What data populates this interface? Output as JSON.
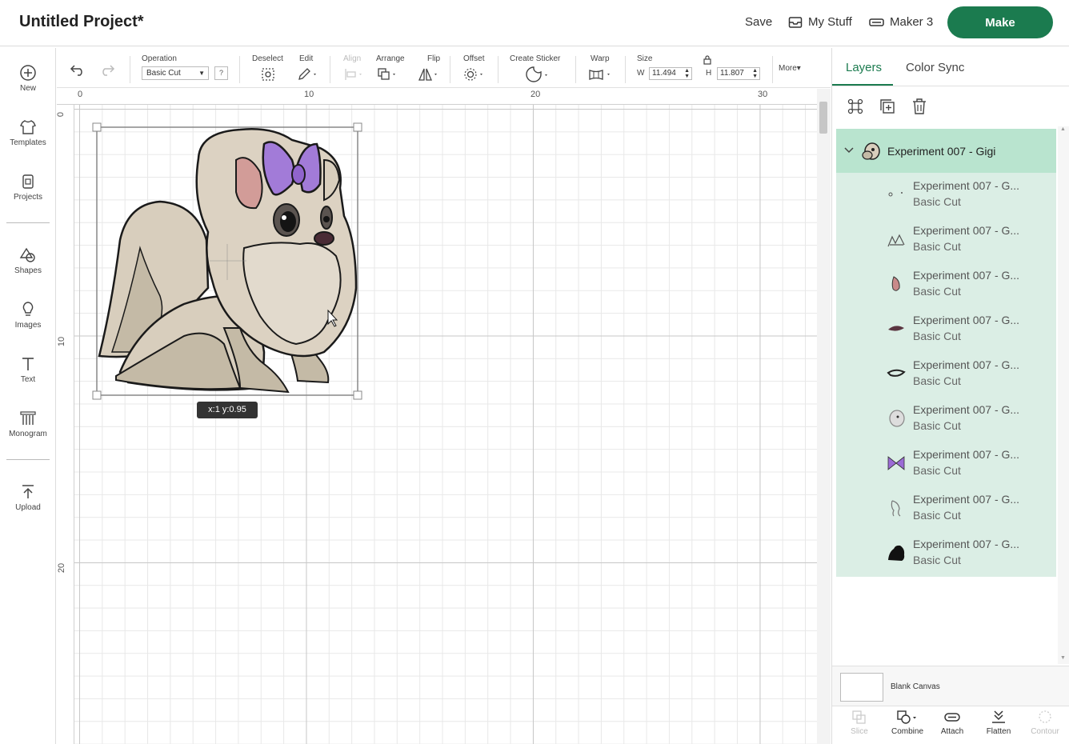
{
  "header": {
    "title": "Untitled Project*",
    "save_label": "Save",
    "my_stuff_label": "My Stuff",
    "machine_label": "Maker 3",
    "make_label": "Make"
  },
  "sidebar": {
    "items": [
      {
        "label": "New",
        "icon": "plus-circle-icon"
      },
      {
        "label": "Templates",
        "icon": "shirt-icon"
      },
      {
        "label": "Projects",
        "icon": "projects-icon"
      },
      {
        "label": "Shapes",
        "icon": "shapes-icon"
      },
      {
        "label": "Images",
        "icon": "lightbulb-icon"
      },
      {
        "label": "Text",
        "icon": "text-icon"
      },
      {
        "label": "Monogram",
        "icon": "monogram-icon"
      },
      {
        "label": "Upload",
        "icon": "upload-icon"
      }
    ]
  },
  "toolbar": {
    "operation_label": "Operation",
    "operation_value": "Basic Cut",
    "help_label": "?",
    "deselect_label": "Deselect",
    "edit_label": "Edit",
    "align_label": "Align",
    "arrange_label": "Arrange",
    "flip_label": "Flip",
    "offset_label": "Offset",
    "sticker_label": "Create Sticker",
    "warp_label": "Warp",
    "size_label": "Size",
    "w_label": "W",
    "w_value": "11.494",
    "h_label": "H",
    "h_value": "11.807",
    "more_label": "More▾"
  },
  "canvas": {
    "ruler_top": [
      "0",
      "10",
      "20",
      "30"
    ],
    "ruler_left": [
      "0",
      "10",
      "20"
    ],
    "coordinate_tooltip": "x:1 y:0.95"
  },
  "panel": {
    "tabs": [
      "Layers",
      "Color Sync"
    ],
    "group_name": "Experiment 007 - Gigi",
    "layers": [
      {
        "name": "Experiment 007 - G...",
        "op": "Basic Cut",
        "thumb": "dots",
        "color": "#555555"
      },
      {
        "name": "Experiment 007 - G...",
        "op": "Basic Cut",
        "thumb": "sketch",
        "color": "#555555"
      },
      {
        "name": "Experiment 007 - G...",
        "op": "Basic Cut",
        "thumb": "ear",
        "color": "#c98a8a"
      },
      {
        "name": "Experiment 007 - G...",
        "op": "Basic Cut",
        "thumb": "nose",
        "color": "#5a3540"
      },
      {
        "name": "Experiment 007 - G...",
        "op": "Basic Cut",
        "thumb": "eye",
        "color": "#222222"
      },
      {
        "name": "Experiment 007 - G...",
        "op": "Basic Cut",
        "thumb": "body",
        "color": "#888888"
      },
      {
        "name": "Experiment 007 - G...",
        "op": "Basic Cut",
        "thumb": "bow",
        "color": "#9b6bd6"
      },
      {
        "name": "Experiment 007 - G...",
        "op": "Basic Cut",
        "thumb": "outline",
        "color": "#777777"
      },
      {
        "name": "Experiment 007 - G...",
        "op": "Basic Cut",
        "thumb": "silhouette",
        "color": "#111111"
      }
    ],
    "blank_canvas_label": "Blank Canvas",
    "bottom_actions": [
      {
        "label": "Slice",
        "enabled": false
      },
      {
        "label": "Combine",
        "enabled": true
      },
      {
        "label": "Attach",
        "enabled": true
      },
      {
        "label": "Flatten",
        "enabled": true
      },
      {
        "label": "Contour",
        "enabled": false
      }
    ]
  },
  "colors": {
    "accent": "#1b7b4f",
    "group_header": "#b9e4cf",
    "group_body": "#dbeee5",
    "fur": "#ddd3c4",
    "fur_shadow": "#c4baa6",
    "bow": "#a27bd8",
    "ear": "#d29c98"
  }
}
